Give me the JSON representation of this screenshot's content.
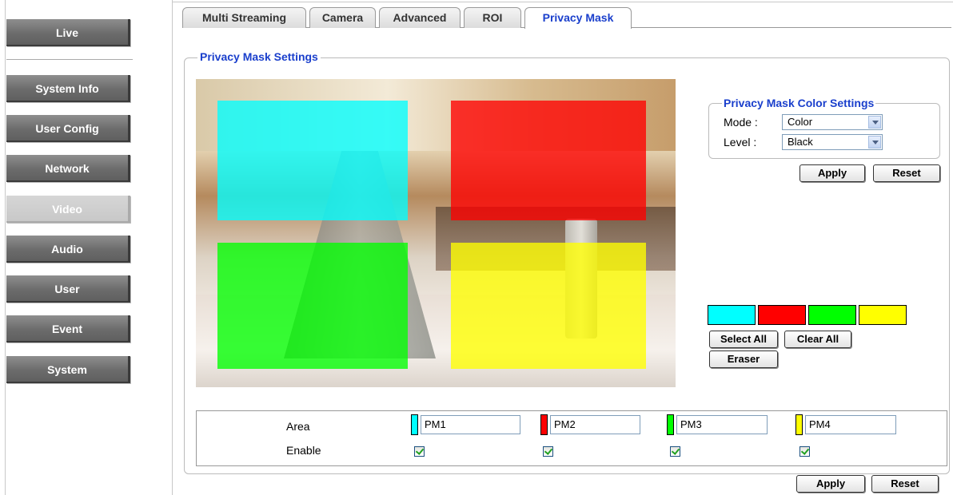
{
  "sidebar": {
    "items": [
      {
        "label": "Live"
      },
      {
        "label": "System Info"
      },
      {
        "label": "User Config"
      },
      {
        "label": "Network"
      },
      {
        "label": "Video",
        "active": true
      },
      {
        "label": "Audio"
      },
      {
        "label": "User"
      },
      {
        "label": "Event"
      },
      {
        "label": "System"
      }
    ]
  },
  "tabs": [
    {
      "label": "Multi Streaming"
    },
    {
      "label": "Camera"
    },
    {
      "label": "Advanced"
    },
    {
      "label": "ROI"
    },
    {
      "label": "Privacy Mask",
      "active": true
    }
  ],
  "main": {
    "legend": "Privacy Mask Settings",
    "masks": [
      {
        "name": "PM1",
        "color": "#00ffff"
      },
      {
        "name": "PM2",
        "color": "#ff0000"
      },
      {
        "name": "PM3",
        "color": "#00ff00"
      },
      {
        "name": "PM4",
        "color": "#ffff00"
      }
    ]
  },
  "color_settings": {
    "legend": "Privacy Mask Color Settings",
    "mode_label": "Mode :",
    "mode_value": "Color",
    "level_label": "Level :",
    "level_value": "Black",
    "apply_label": "Apply",
    "reset_label": "Reset"
  },
  "palette": {
    "colors": [
      "#00ffff",
      "#ff0000",
      "#00ff00",
      "#ffff00"
    ],
    "select_all_label": "Select All",
    "clear_all_label": "Clear All",
    "eraser_label": "Eraser"
  },
  "area_table": {
    "area_label": "Area",
    "enable_label": "Enable",
    "rows": [
      {
        "value": "PM1",
        "enabled": true
      },
      {
        "value": "PM2",
        "enabled": true
      },
      {
        "value": "PM3",
        "enabled": true
      },
      {
        "value": "PM4",
        "enabled": true
      }
    ]
  },
  "footer": {
    "apply_label": "Apply",
    "reset_label": "Reset"
  }
}
